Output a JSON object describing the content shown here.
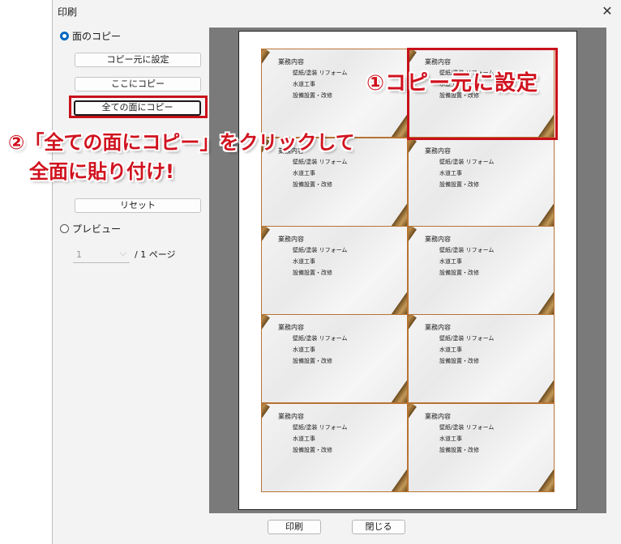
{
  "window": {
    "title": "印刷",
    "close_glyph": "✕"
  },
  "left_panel": {
    "radio_copy": {
      "label": "面のコピー",
      "selected": true
    },
    "btn_set_source": "コピー元に設定",
    "btn_copy_here": "ここにコピー",
    "btn_copy_all": "全ての面にコピー",
    "btn_reset": "リセット",
    "radio_preview": {
      "label": "プレビュー",
      "selected": false
    },
    "page_select": {
      "value": "1",
      "chevron": "⌵"
    },
    "page_of": "/ 1 ページ"
  },
  "card": {
    "heading": "業務内容",
    "lines": [
      "壁紙/塗装 リフォーム",
      "水道工事",
      "設備設置・改修"
    ]
  },
  "annotations": {
    "step1": "①コピー元に設定",
    "step2_line1": "②「全ての面にコピー」をクリックして",
    "step2_line2": "全面に貼り付け!",
    "accent": "#d0121e"
  },
  "bottom": {
    "print": "印刷",
    "close": "閉じる"
  }
}
